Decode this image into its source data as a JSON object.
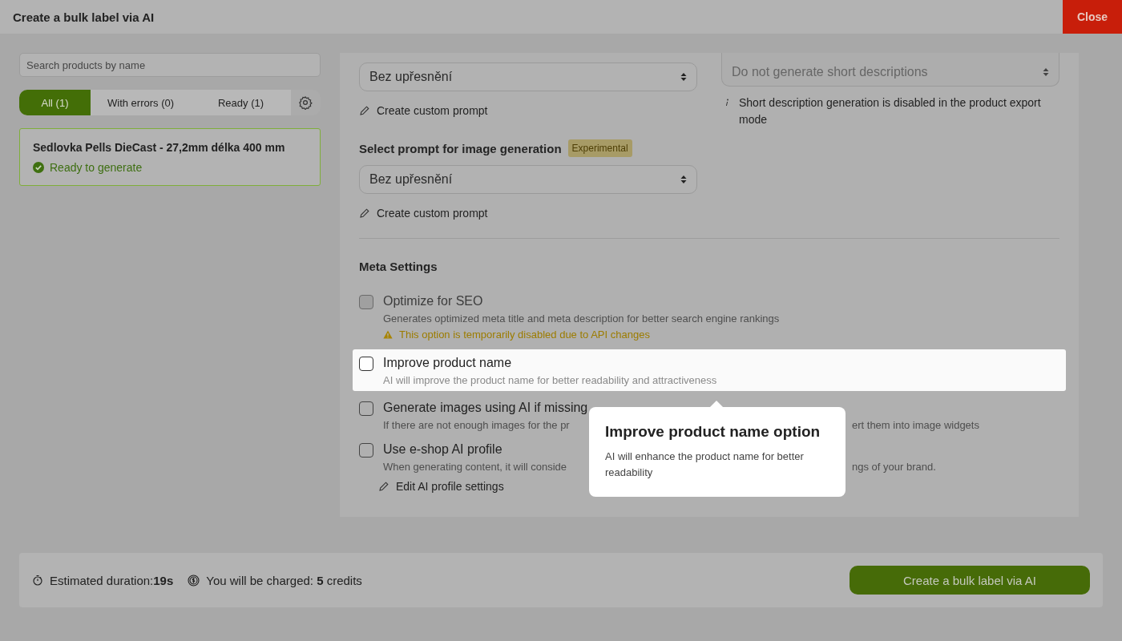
{
  "window": {
    "title": "Create a bulk label via AI",
    "close_button": "Close"
  },
  "sidebar": {
    "search": {
      "placeholder": "Search products by name"
    },
    "tabs": [
      {
        "label": "All (1)",
        "selected": true
      },
      {
        "label": "With errors (0)",
        "selected": false
      },
      {
        "label": "Ready (1)",
        "selected": false
      }
    ],
    "products": [
      {
        "name": "Sedlovka Pells DieCast - 27,2mm délka 400 mm",
        "status": "Ready to generate",
        "ready": true
      }
    ]
  },
  "prompts": {
    "text_select": {
      "value": "Bez upřesnění"
    },
    "text_custom_link": "Create custom prompt",
    "short_select": {
      "value": "Do not generate short descriptions",
      "disabled": true
    },
    "short_note": "Short description generation is disabled in the product export mode",
    "image_heading": "Select prompt for image generation",
    "image_badge": "Experimental",
    "image_select": {
      "value": "Bez upřesnění"
    },
    "image_custom_link": "Create custom prompt"
  },
  "meta": {
    "heading": "Meta Settings",
    "options": [
      {
        "label": "Optimize for SEO",
        "description": [
          "Generates optimized meta title and meta description for better search engine rankings"
        ],
        "checked": false,
        "disabled": true,
        "highlighted": false,
        "warning": "This option is temporarily disabled due to API changes"
      },
      {
        "label": "Improve product name",
        "description": [
          "AI will improve the product name for better readability and attractiveness"
        ],
        "checked": false,
        "disabled": false,
        "highlighted": true
      },
      {
        "label": "Generate images using AI if missing",
        "description": [
          "If there are not enough images for the pr",
          "ert them into image widgets"
        ],
        "checked": false,
        "disabled": false,
        "highlighted": false
      },
      {
        "label": "Use e-shop AI profile",
        "description": [
          "When generating content, it will conside",
          "ngs of your brand."
        ],
        "checked": false,
        "disabled": false,
        "highlighted": false,
        "link": "Edit AI profile settings"
      }
    ]
  },
  "tooltip": {
    "title": "Improve product name option",
    "text": "AI will enhance the product name for better readability"
  },
  "footer": {
    "duration": "Estimated duration:**19s**",
    "charge": "You will be charged: **5** credits",
    "button": "Create a bulk label via AI"
  }
}
